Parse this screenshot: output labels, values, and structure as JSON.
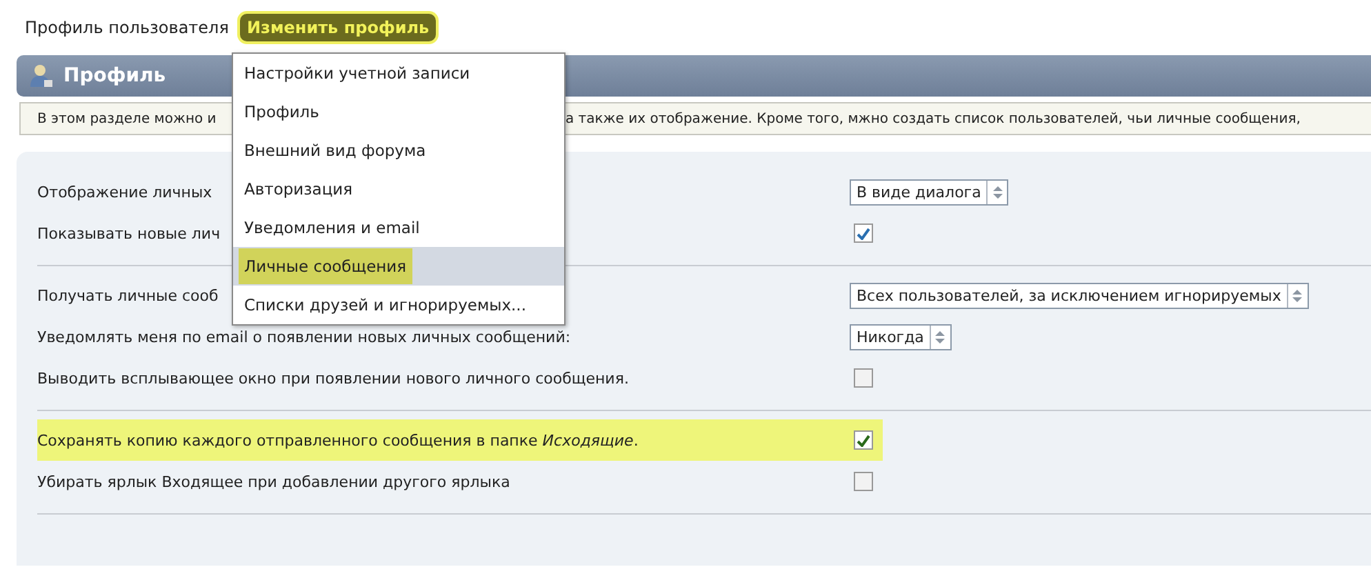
{
  "nav": {
    "link": "Профиль пользователя",
    "button": "Изменить профиль"
  },
  "panel": {
    "title": "Профиль"
  },
  "intro": [
    "В этом разделе можно и",
    "а также их отображение. Кроме того, мжно создать список пользователей, чьи личные сообщения,"
  ],
  "sections": [
    {
      "rows": [
        {
          "label": "Отображение личных",
          "kind": "select",
          "value": "В виде диалога",
          "highlighted": false
        },
        {
          "label": "Показывать новые лич",
          "kind": "checkbox",
          "checked": true,
          "highlighted": false
        }
      ]
    },
    {
      "rows": [
        {
          "label": "Получать личные сооб",
          "kind": "select",
          "value": "Всех пользователей, за исключением игнорируемых",
          "highlighted": false
        },
        {
          "label": "Уведомлять меня по email о появлении новых личных сообщений:",
          "kind": "select",
          "value": "Никогда",
          "highlighted": false
        },
        {
          "label": "Выводить всплывающее окно при появлении нового личного сообщения.",
          "kind": "checkbox",
          "checked": false,
          "highlighted": false
        }
      ]
    },
    {
      "rows": [
        {
          "label": "Сохранять копию каждого отправленного сообщения в папке *Исходящие*.",
          "kind": "checkbox",
          "checked": true,
          "highlighted": true
        },
        {
          "label": "Убирать ярлык Входящее при добавлении другого ярлыка",
          "kind": "checkbox",
          "checked": false,
          "highlighted": false
        }
      ]
    }
  ],
  "menu": [
    {
      "label": "Настройки учетной записи",
      "selected": false
    },
    {
      "label": "Профиль",
      "selected": false
    },
    {
      "label": "Внешний вид форума",
      "selected": false
    },
    {
      "label": "Авторизация",
      "selected": false
    },
    {
      "label": "Уведомления и email",
      "selected": false
    },
    {
      "label": "Личные сообщения",
      "selected": true
    },
    {
      "label": "Списки друзей и игнорируемых...",
      "selected": false
    }
  ]
}
